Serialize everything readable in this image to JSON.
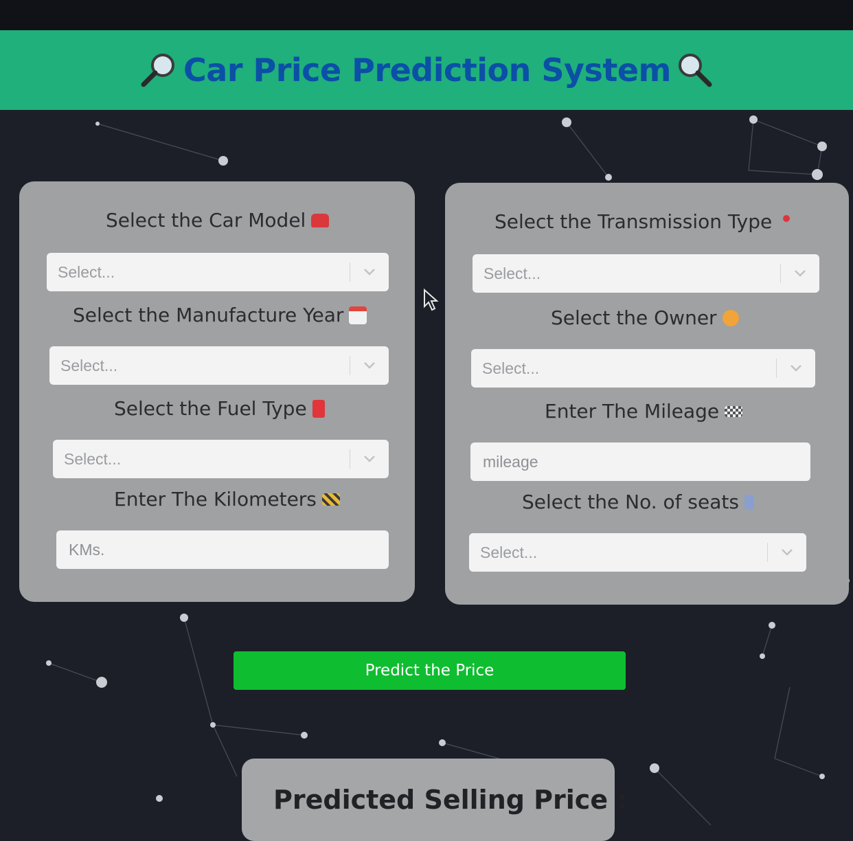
{
  "header": {
    "title": "Car Price Prediction System",
    "icon_left": "magnifier-icon",
    "icon_right": "magnifier-icon",
    "bg_color": "#1fb07c",
    "title_color": "#0b4fa6"
  },
  "left_card": {
    "car_model": {
      "label": "Select the Car Model",
      "icon": "car-icon",
      "value": "Select..."
    },
    "year": {
      "label": "Select the Manufacture Year",
      "icon": "calendar-icon",
      "value": "Select..."
    },
    "fuel": {
      "label": "Select the Fuel Type",
      "icon": "fuel-pump-icon",
      "value": "Select..."
    },
    "km": {
      "label": "Enter The Kilometers",
      "icon": "construction-icon",
      "placeholder": "KMs."
    }
  },
  "right_card": {
    "transmission": {
      "label": "Select the Transmission Type",
      "icon": "pin-icon",
      "value": "Select..."
    },
    "owner": {
      "label": "Select the Owner",
      "icon": "person-icon",
      "value": "Select..."
    },
    "mileage": {
      "label": "Enter The Mileage",
      "icon": "checkered-flag-icon",
      "placeholder": "mileage"
    },
    "seats": {
      "label": "Select the No. of seats",
      "icon": "seat-icon",
      "value": "Select..."
    }
  },
  "predict_button": {
    "label": "Predict the Price",
    "color": "#0fbd30"
  },
  "result": {
    "title": "Predicted Selling Price :"
  }
}
